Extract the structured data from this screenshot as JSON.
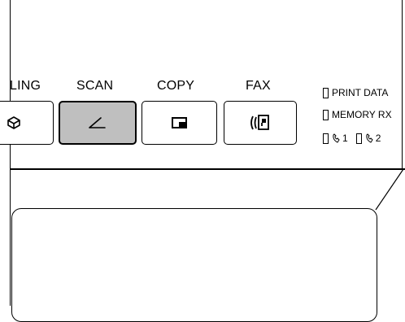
{
  "modes": [
    {
      "label": "LING",
      "icon": "mailbox-icon",
      "active": false
    },
    {
      "label": "SCAN",
      "icon": "scan-icon",
      "active": true
    },
    {
      "label": "COPY",
      "icon": "copy-icon",
      "active": false
    },
    {
      "label": "FAX",
      "icon": "fax-icon",
      "active": false
    }
  ],
  "status": {
    "print_data": "PRINT DATA",
    "memory_rx": "MEMORY RX",
    "line1": "1",
    "line2": "2",
    "line_icon": "phone-handset-icon"
  },
  "colors": {
    "active_button": "#bfbfbf",
    "outline": "#000000",
    "background": "#ffffff"
  }
}
